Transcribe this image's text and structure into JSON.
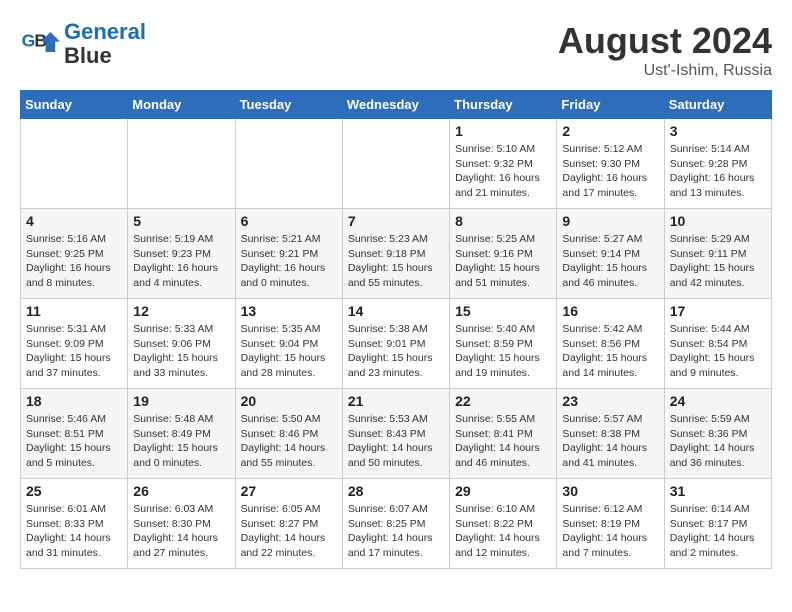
{
  "header": {
    "logo_line1": "General",
    "logo_line2": "Blue",
    "month_year": "August 2024",
    "location": "Ust'-Ishim, Russia"
  },
  "weekdays": [
    "Sunday",
    "Monday",
    "Tuesday",
    "Wednesday",
    "Thursday",
    "Friday",
    "Saturday"
  ],
  "weeks": [
    [
      {
        "day": "",
        "info": ""
      },
      {
        "day": "",
        "info": ""
      },
      {
        "day": "",
        "info": ""
      },
      {
        "day": "",
        "info": ""
      },
      {
        "day": "1",
        "info": "Sunrise: 5:10 AM\nSunset: 9:32 PM\nDaylight: 16 hours\nand 21 minutes."
      },
      {
        "day": "2",
        "info": "Sunrise: 5:12 AM\nSunset: 9:30 PM\nDaylight: 16 hours\nand 17 minutes."
      },
      {
        "day": "3",
        "info": "Sunrise: 5:14 AM\nSunset: 9:28 PM\nDaylight: 16 hours\nand 13 minutes."
      }
    ],
    [
      {
        "day": "4",
        "info": "Sunrise: 5:16 AM\nSunset: 9:25 PM\nDaylight: 16 hours\nand 8 minutes."
      },
      {
        "day": "5",
        "info": "Sunrise: 5:19 AM\nSunset: 9:23 PM\nDaylight: 16 hours\nand 4 minutes."
      },
      {
        "day": "6",
        "info": "Sunrise: 5:21 AM\nSunset: 9:21 PM\nDaylight: 16 hours\nand 0 minutes."
      },
      {
        "day": "7",
        "info": "Sunrise: 5:23 AM\nSunset: 9:18 PM\nDaylight: 15 hours\nand 55 minutes."
      },
      {
        "day": "8",
        "info": "Sunrise: 5:25 AM\nSunset: 9:16 PM\nDaylight: 15 hours\nand 51 minutes."
      },
      {
        "day": "9",
        "info": "Sunrise: 5:27 AM\nSunset: 9:14 PM\nDaylight: 15 hours\nand 46 minutes."
      },
      {
        "day": "10",
        "info": "Sunrise: 5:29 AM\nSunset: 9:11 PM\nDaylight: 15 hours\nand 42 minutes."
      }
    ],
    [
      {
        "day": "11",
        "info": "Sunrise: 5:31 AM\nSunset: 9:09 PM\nDaylight: 15 hours\nand 37 minutes."
      },
      {
        "day": "12",
        "info": "Sunrise: 5:33 AM\nSunset: 9:06 PM\nDaylight: 15 hours\nand 33 minutes."
      },
      {
        "day": "13",
        "info": "Sunrise: 5:35 AM\nSunset: 9:04 PM\nDaylight: 15 hours\nand 28 minutes."
      },
      {
        "day": "14",
        "info": "Sunrise: 5:38 AM\nSunset: 9:01 PM\nDaylight: 15 hours\nand 23 minutes."
      },
      {
        "day": "15",
        "info": "Sunrise: 5:40 AM\nSunset: 8:59 PM\nDaylight: 15 hours\nand 19 minutes."
      },
      {
        "day": "16",
        "info": "Sunrise: 5:42 AM\nSunset: 8:56 PM\nDaylight: 15 hours\nand 14 minutes."
      },
      {
        "day": "17",
        "info": "Sunrise: 5:44 AM\nSunset: 8:54 PM\nDaylight: 15 hours\nand 9 minutes."
      }
    ],
    [
      {
        "day": "18",
        "info": "Sunrise: 5:46 AM\nSunset: 8:51 PM\nDaylight: 15 hours\nand 5 minutes."
      },
      {
        "day": "19",
        "info": "Sunrise: 5:48 AM\nSunset: 8:49 PM\nDaylight: 15 hours\nand 0 minutes."
      },
      {
        "day": "20",
        "info": "Sunrise: 5:50 AM\nSunset: 8:46 PM\nDaylight: 14 hours\nand 55 minutes."
      },
      {
        "day": "21",
        "info": "Sunrise: 5:53 AM\nSunset: 8:43 PM\nDaylight: 14 hours\nand 50 minutes."
      },
      {
        "day": "22",
        "info": "Sunrise: 5:55 AM\nSunset: 8:41 PM\nDaylight: 14 hours\nand 46 minutes."
      },
      {
        "day": "23",
        "info": "Sunrise: 5:57 AM\nSunset: 8:38 PM\nDaylight: 14 hours\nand 41 minutes."
      },
      {
        "day": "24",
        "info": "Sunrise: 5:59 AM\nSunset: 8:36 PM\nDaylight: 14 hours\nand 36 minutes."
      }
    ],
    [
      {
        "day": "25",
        "info": "Sunrise: 6:01 AM\nSunset: 8:33 PM\nDaylight: 14 hours\nand 31 minutes."
      },
      {
        "day": "26",
        "info": "Sunrise: 6:03 AM\nSunset: 8:30 PM\nDaylight: 14 hours\nand 27 minutes."
      },
      {
        "day": "27",
        "info": "Sunrise: 6:05 AM\nSunset: 8:27 PM\nDaylight: 14 hours\nand 22 minutes."
      },
      {
        "day": "28",
        "info": "Sunrise: 6:07 AM\nSunset: 8:25 PM\nDaylight: 14 hours\nand 17 minutes."
      },
      {
        "day": "29",
        "info": "Sunrise: 6:10 AM\nSunset: 8:22 PM\nDaylight: 14 hours\nand 12 minutes."
      },
      {
        "day": "30",
        "info": "Sunrise: 6:12 AM\nSunset: 8:19 PM\nDaylight: 14 hours\nand 7 minutes."
      },
      {
        "day": "31",
        "info": "Sunrise: 6:14 AM\nSunset: 8:17 PM\nDaylight: 14 hours\nand 2 minutes."
      }
    ]
  ]
}
